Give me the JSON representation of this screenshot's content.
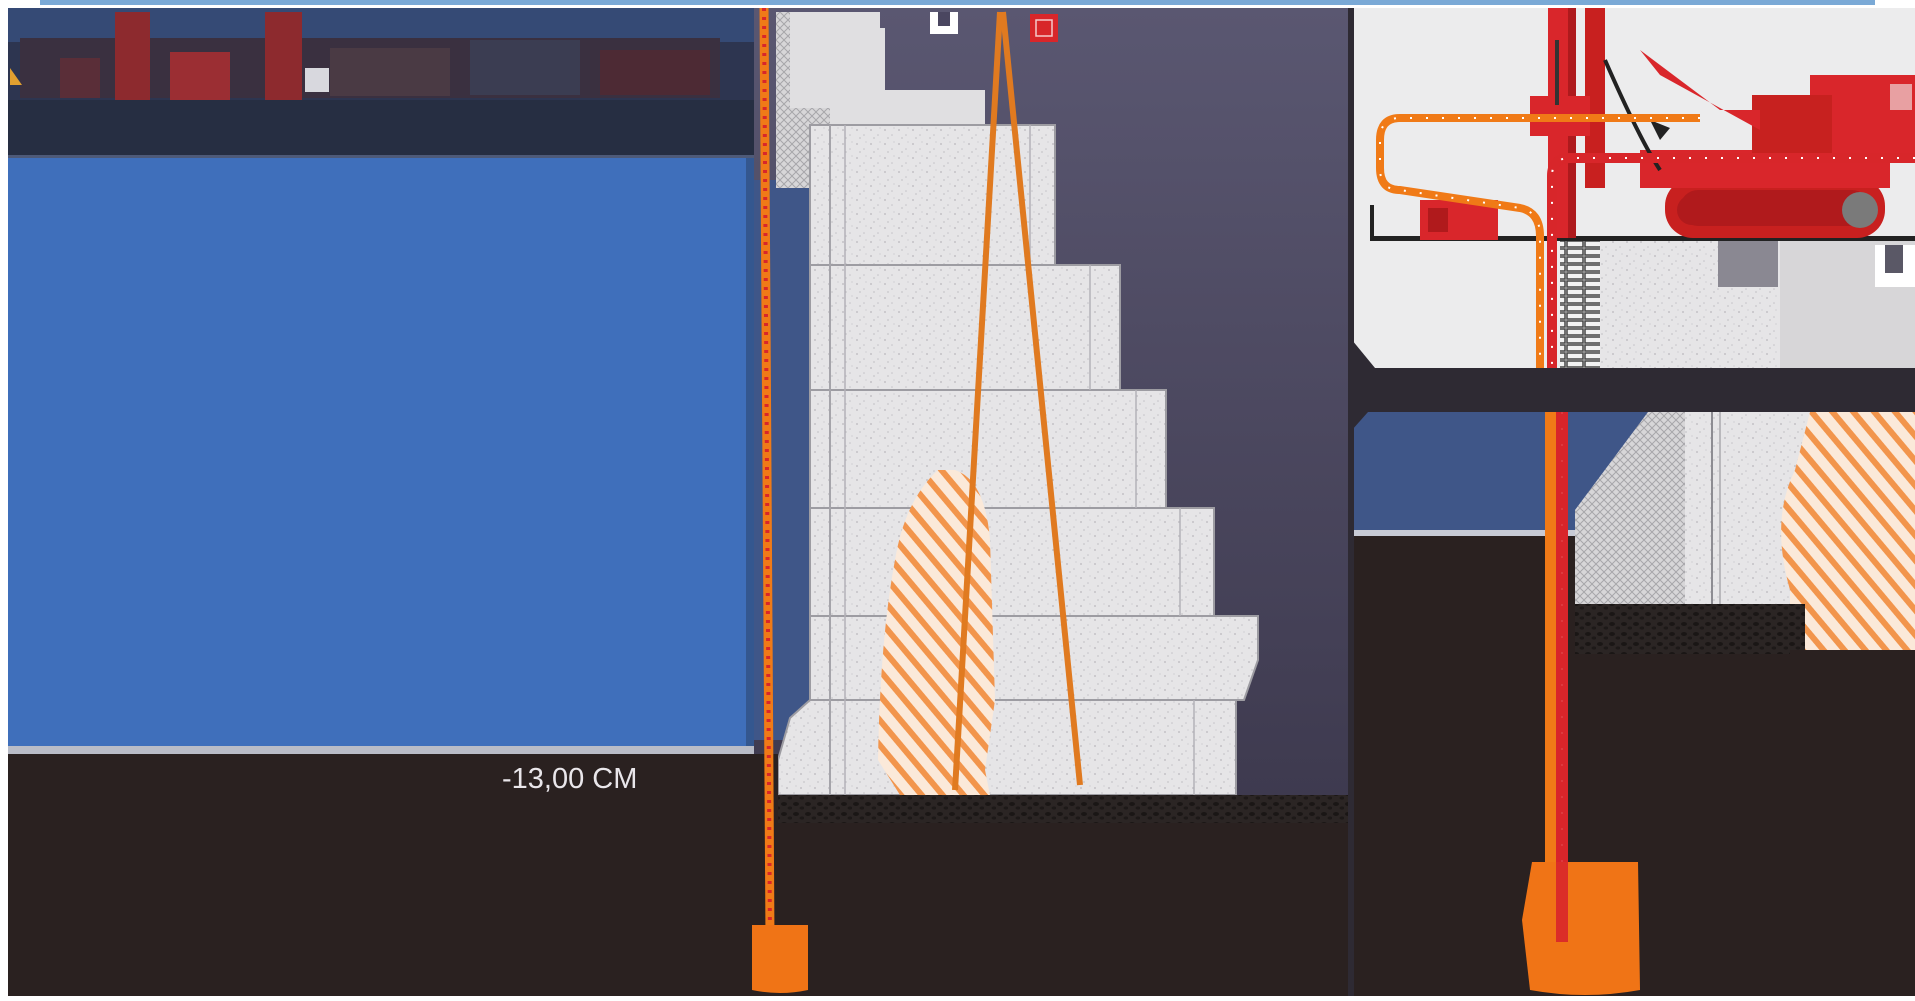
{
  "diagram": {
    "depth_label": "-13,00 CM"
  },
  "colors": {
    "water": "#3f6fbb",
    "water_deep": "#34578f",
    "ground_dark": "#2a2120",
    "night_sky": "#4a4660",
    "quay_blocks": "#e4e3e4",
    "grout_orange": "#f07a17",
    "pipe_red": "#d8262a",
    "rig_red": "#d9262b",
    "hatch_orange": "#f2954c"
  }
}
